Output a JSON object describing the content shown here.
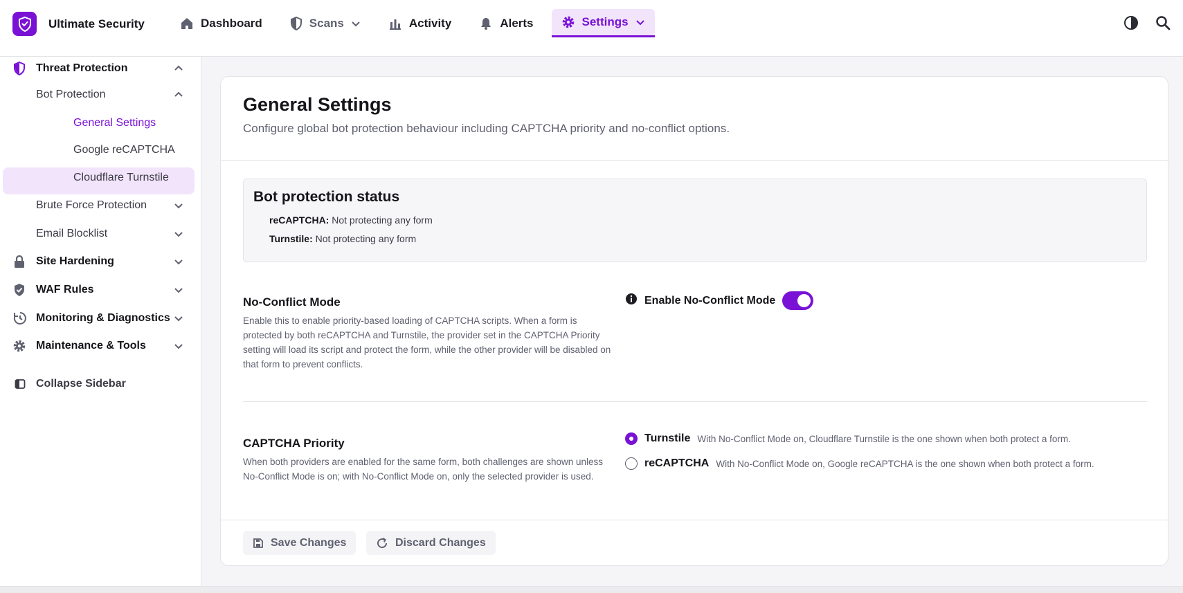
{
  "brand": {
    "name": "Ultimate Security"
  },
  "nav": {
    "dashboard": "Dashboard",
    "scans": "Scans",
    "activity": "Activity",
    "alerts": "Alerts",
    "settings": "Settings"
  },
  "sidebar": {
    "threat_protection": "Threat Protection",
    "bot_protection": "Bot Protection",
    "general_settings": "General Settings",
    "google_recaptcha": "Google reCAPTCHA",
    "cloudflare_turnstile": "Cloudflare Turnstile",
    "brute_force": "Brute Force Protection",
    "email_blocklist": "Email Blocklist",
    "site_hardening": "Site Hardening",
    "waf_rules": "WAF Rules",
    "monitoring": "Monitoring & Diagnostics",
    "maintenance": "Maintenance & Tools",
    "collapse": "Collapse Sidebar"
  },
  "page": {
    "title": "General Settings",
    "subtitle": "Configure global bot protection behaviour including CAPTCHA priority and no-conflict options."
  },
  "status": {
    "title": "Bot protection status",
    "recaptcha_label": "reCAPTCHA:",
    "recaptcha_value": " Not protecting any form",
    "turnstile_label": "Turnstile:",
    "turnstile_value": " Not protecting any form"
  },
  "no_conflict": {
    "title": "No-Conflict Mode",
    "description": "Enable this to enable priority-based loading of CAPTCHA scripts. When a form is protected by both reCAPTCHA and Turnstile, the provider set in the CAPTCHA Priority setting will load its script and protect the form, while the other provider will be disabled on that form to prevent conflicts.",
    "toggle_label": "Enable No-Conflict Mode",
    "enabled": true
  },
  "priority": {
    "title": "CAPTCHA Priority",
    "description": "When both providers are enabled for the same form, both challenges are shown unless No-Conflict Mode is on; with No-Conflict Mode on, only the selected provider is used.",
    "options": [
      {
        "label": "Turnstile",
        "description": "With No-Conflict Mode on, Cloudflare Turnstile is the one shown when both protect a form.",
        "selected": true
      },
      {
        "label": "reCAPTCHA",
        "description": "With No-Conflict Mode on, Google reCAPTCHA is the one shown when both protect a form.",
        "selected": false
      }
    ]
  },
  "footer": {
    "save": "Save Changes",
    "discard": "Discard Changes"
  },
  "colors": {
    "accent": "#7a12d6",
    "accent_light": "#f2e4fb",
    "text": "#15151a",
    "muted": "#5f6170"
  },
  "icons": [
    "shield-check-logo",
    "home-icon",
    "shield-icon",
    "bar-chart-icon",
    "bell-icon",
    "gear-icon",
    "chevron-down-icon",
    "chevron-up-icon",
    "theme-toggle-icon",
    "search-icon",
    "lock-icon",
    "shield-check-icon",
    "clock-history-icon",
    "sidebar-collapse-icon",
    "info-icon",
    "save-icon",
    "refresh-icon"
  ]
}
